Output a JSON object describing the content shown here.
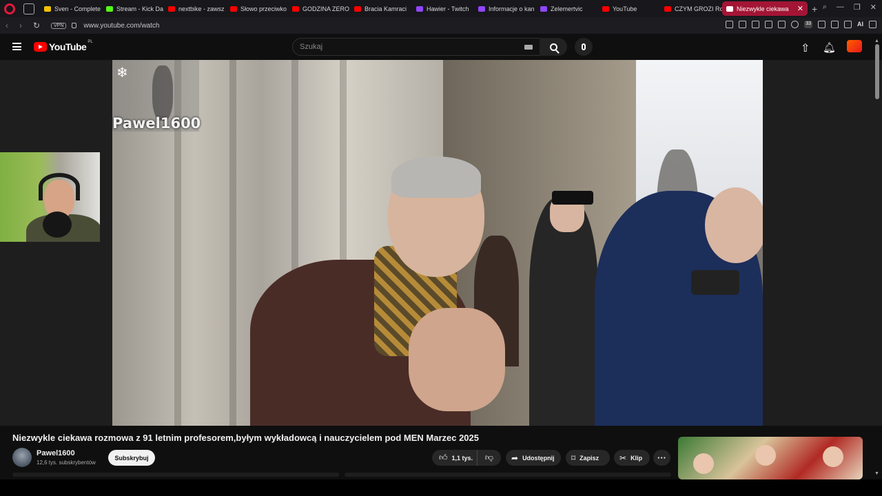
{
  "browser": {
    "tabs": [
      {
        "label": "Sven - Complete",
        "color": "#f2c200"
      },
      {
        "label": "Stream - Kick Da",
        "color": "#53fc18"
      },
      {
        "label": "nextbike - zawsz",
        "color": "#ff0000"
      },
      {
        "label": "Słowo przeciwko",
        "color": "#ff0000"
      },
      {
        "label": "GODZINA ZERO",
        "color": "#ff0000"
      },
      {
        "label": "Bracia Kamraci",
        "color": "#ff0000"
      },
      {
        "label": "Hawier - Twitch",
        "color": "#9146ff"
      },
      {
        "label": "Informacje o kan",
        "color": "#9146ff"
      },
      {
        "label": "Zelemertvic",
        "color": "#9146ff"
      },
      {
        "label": "YouTube",
        "color": "#ff0000"
      },
      {
        "label": "CZYM GROZI Ro",
        "color": "#ff0000"
      }
    ],
    "active_tab": {
      "label": "Niezwykle ciekawa",
      "close": "✕"
    },
    "new_tab": "+",
    "vpn": "VPN",
    "url": "www.youtube.com/watch",
    "ext_badge": "33",
    "ai_label": "AI"
  },
  "youtube": {
    "logo_text": "YouTube",
    "country": "PL",
    "search_placeholder": "Szukaj"
  },
  "video": {
    "watermark": "Pawel1600",
    "title": "Niezwykle ciekawa rozmowa z 91 letnim profesorem,byłym wykładowcą i nauczycielem pod MEN Marzec 2025"
  },
  "channel": {
    "name": "Pawel1600",
    "subscribers": "12,6 tys. subskrybentów",
    "subscribe_label": "Subskrybuj"
  },
  "actions": {
    "likes": "1,1 tys.",
    "share": "Udostępnij",
    "save": "Zapisz",
    "clip": "Klip",
    "more": "···"
  }
}
